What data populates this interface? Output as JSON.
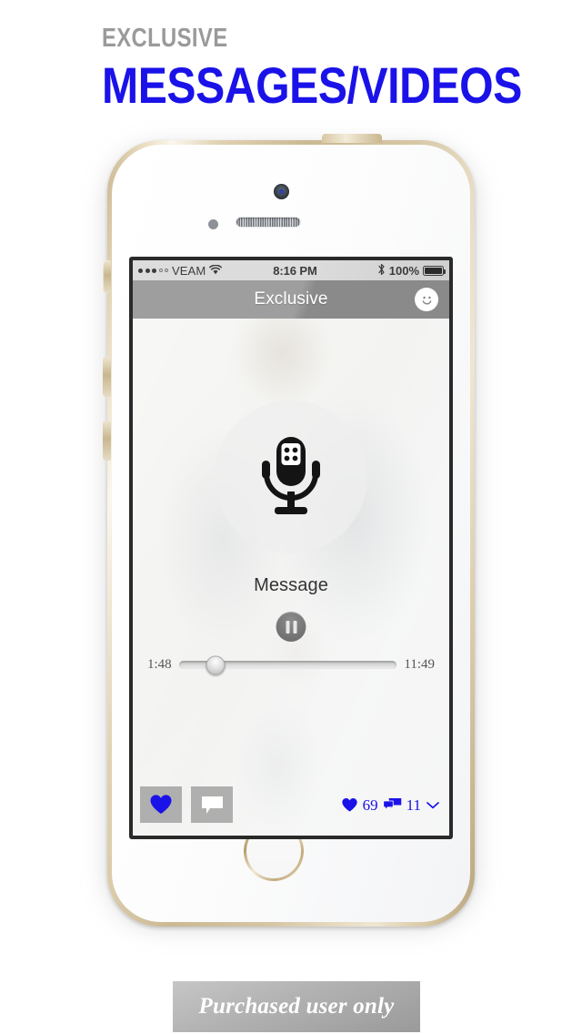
{
  "promo": {
    "kicker": "EXCLUSIVE",
    "title": "MESSAGES/VIDEOS",
    "kicker_color": "#9a9a9a",
    "title_color": "#1a12e8"
  },
  "status_bar": {
    "signal_dots_filled": 3,
    "signal_dots_total": 5,
    "carrier": "VEAM",
    "wifi_icon": "wifi-icon",
    "time": "8:16 PM",
    "bluetooth_icon": "bluetooth-icon",
    "battery_percent": "100%",
    "battery_level": 100
  },
  "nav_bar": {
    "title": "Exclusive",
    "right_icon": "smiley-face-icon"
  },
  "player": {
    "media_icon": "microphone-icon",
    "track_title": "Message",
    "transport_state": "pause-icon",
    "elapsed_time": "1:48",
    "total_time": "11:49",
    "progress_percent": 17
  },
  "actions": {
    "like_icon": "heart-icon",
    "like_active": true,
    "comment_icon": "speech-bubble-icon",
    "like_count": "69",
    "comment_count": "11",
    "expand_icon": "chevron-down-icon",
    "accent_color": "#1a12e8"
  },
  "banner": {
    "text": "Purchased user only"
  }
}
